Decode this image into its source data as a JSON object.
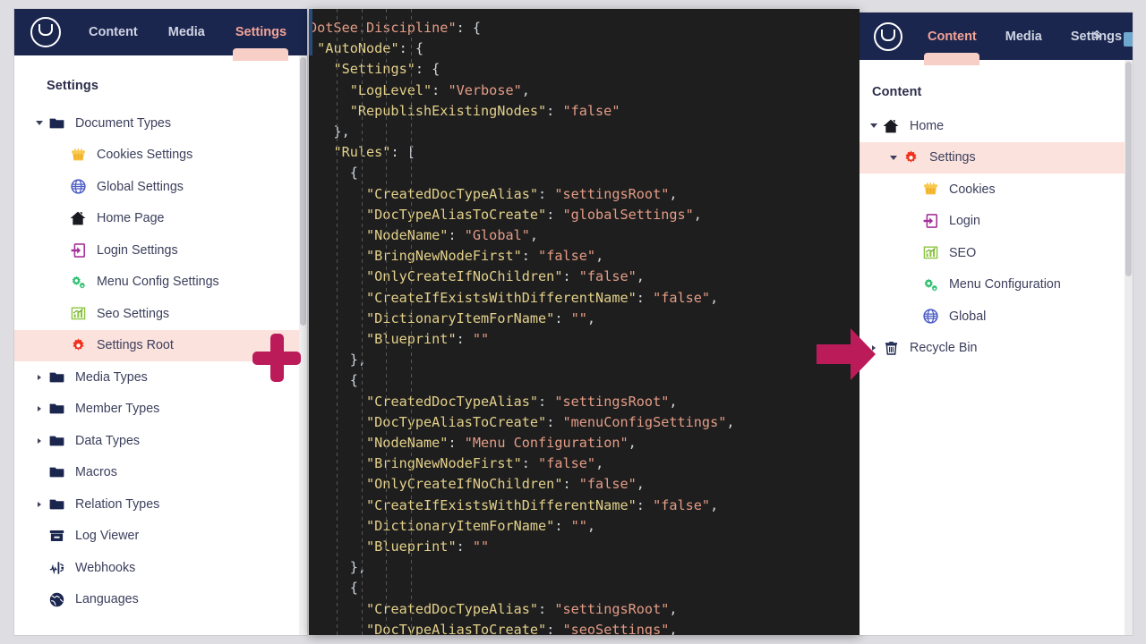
{
  "left_window": {
    "nav": {
      "logo_icon": "umbraco-logo-icon",
      "tabs": [
        {
          "label": "Content",
          "active": false
        },
        {
          "label": "Media",
          "active": false
        },
        {
          "label": "Settings",
          "active": true
        }
      ],
      "cut_text": "s"
    },
    "panel_title": "Settings",
    "tree": [
      {
        "label": "Document Types",
        "icon": "folder-icon",
        "caret": "open",
        "depth": 0,
        "selected": false
      },
      {
        "label": "Cookies Settings",
        "icon": "cookie-icon",
        "caret": "none",
        "depth": 1,
        "selected": false
      },
      {
        "label": "Global Settings",
        "icon": "globe-icon",
        "caret": "none",
        "depth": 1,
        "selected": false
      },
      {
        "label": "Home Page",
        "icon": "home-icon",
        "caret": "none",
        "depth": 1,
        "selected": false
      },
      {
        "label": "Login Settings",
        "icon": "login-icon",
        "caret": "none",
        "depth": 1,
        "selected": false
      },
      {
        "label": "Menu Config Settings",
        "icon": "gears-icon",
        "caret": "none",
        "depth": 1,
        "selected": false
      },
      {
        "label": "Seo Settings",
        "icon": "bar-chart-icon",
        "caret": "none",
        "depth": 1,
        "selected": false
      },
      {
        "label": "Settings Root",
        "icon": "gear-icon",
        "caret": "none",
        "depth": 1,
        "selected": true
      },
      {
        "label": "Media Types",
        "icon": "folder-icon",
        "caret": "closed",
        "depth": 0,
        "selected": false
      },
      {
        "label": "Member Types",
        "icon": "folder-icon",
        "caret": "closed",
        "depth": 0,
        "selected": false
      },
      {
        "label": "Data Types",
        "icon": "folder-icon",
        "caret": "closed",
        "depth": 0,
        "selected": false
      },
      {
        "label": "Macros",
        "icon": "folder-icon",
        "caret": "none",
        "depth": 0,
        "selected": false
      },
      {
        "label": "Relation Types",
        "icon": "folder-icon",
        "caret": "closed",
        "depth": 0,
        "selected": false
      },
      {
        "label": "Log Viewer",
        "icon": "log-viewer-icon",
        "caret": "none",
        "depth": 0,
        "selected": false
      },
      {
        "label": "Webhooks",
        "icon": "webhook-icon",
        "caret": "none",
        "depth": 0,
        "selected": false
      },
      {
        "label": "Languages",
        "icon": "language-globe-icon",
        "caret": "none",
        "depth": 0,
        "selected": false
      }
    ]
  },
  "code_panel": {
    "language": "json",
    "lines": [
      [
        {
          "t": "s",
          "v": "DotSee.Discipline\""
        },
        {
          "t": "p",
          "v": ": {"
        }
      ],
      [
        {
          "t": "p",
          "v": " "
        },
        {
          "t": "k",
          "v": "\"AutoNode\""
        },
        {
          "t": "p",
          "v": ": {"
        }
      ],
      [
        {
          "t": "p",
          "v": "   "
        },
        {
          "t": "k",
          "v": "\"Settings\""
        },
        {
          "t": "p",
          "v": ": {"
        }
      ],
      [
        {
          "t": "p",
          "v": "     "
        },
        {
          "t": "k",
          "v": "\"LogLevel\""
        },
        {
          "t": "p",
          "v": ": "
        },
        {
          "t": "s",
          "v": "\"Verbose\""
        },
        {
          "t": "p",
          "v": ","
        }
      ],
      [
        {
          "t": "p",
          "v": "     "
        },
        {
          "t": "k",
          "v": "\"RepublishExistingNodes\""
        },
        {
          "t": "p",
          "v": ": "
        },
        {
          "t": "s",
          "v": "\"false\""
        }
      ],
      [
        {
          "t": "p",
          "v": "   },"
        }
      ],
      [
        {
          "t": "p",
          "v": "   "
        },
        {
          "t": "k",
          "v": "\"Rules\""
        },
        {
          "t": "p",
          "v": ": ["
        }
      ],
      [
        {
          "t": "p",
          "v": "     {"
        }
      ],
      [
        {
          "t": "p",
          "v": "       "
        },
        {
          "t": "k",
          "v": "\"CreatedDocTypeAlias\""
        },
        {
          "t": "p",
          "v": ": "
        },
        {
          "t": "s",
          "v": "\"settingsRoot\""
        },
        {
          "t": "p",
          "v": ","
        }
      ],
      [
        {
          "t": "p",
          "v": "       "
        },
        {
          "t": "k",
          "v": "\"DocTypeAliasToCreate\""
        },
        {
          "t": "p",
          "v": ": "
        },
        {
          "t": "s",
          "v": "\"globalSettings\""
        },
        {
          "t": "p",
          "v": ","
        }
      ],
      [
        {
          "t": "p",
          "v": "       "
        },
        {
          "t": "k",
          "v": "\"NodeName\""
        },
        {
          "t": "p",
          "v": ": "
        },
        {
          "t": "s",
          "v": "\"Global\""
        },
        {
          "t": "p",
          "v": ","
        }
      ],
      [
        {
          "t": "p",
          "v": "       "
        },
        {
          "t": "k",
          "v": "\"BringNewNodeFirst\""
        },
        {
          "t": "p",
          "v": ": "
        },
        {
          "t": "s",
          "v": "\"false\""
        },
        {
          "t": "p",
          "v": ","
        }
      ],
      [
        {
          "t": "p",
          "v": "       "
        },
        {
          "t": "k",
          "v": "\"OnlyCreateIfNoChildren\""
        },
        {
          "t": "p",
          "v": ": "
        },
        {
          "t": "s",
          "v": "\"false\""
        },
        {
          "t": "p",
          "v": ","
        }
      ],
      [
        {
          "t": "p",
          "v": "       "
        },
        {
          "t": "k",
          "v": "\"CreateIfExistsWithDifferentName\""
        },
        {
          "t": "p",
          "v": ": "
        },
        {
          "t": "s",
          "v": "\"false\""
        },
        {
          "t": "p",
          "v": ","
        }
      ],
      [
        {
          "t": "p",
          "v": "       "
        },
        {
          "t": "k",
          "v": "\"DictionaryItemForName\""
        },
        {
          "t": "p",
          "v": ": "
        },
        {
          "t": "s",
          "v": "\"\""
        },
        {
          "t": "p",
          "v": ","
        }
      ],
      [
        {
          "t": "p",
          "v": "       "
        },
        {
          "t": "k",
          "v": "\"Blueprint\""
        },
        {
          "t": "p",
          "v": ": "
        },
        {
          "t": "s",
          "v": "\"\""
        }
      ],
      [
        {
          "t": "p",
          "v": "     },"
        }
      ],
      [
        {
          "t": "p",
          "v": "     {"
        }
      ],
      [
        {
          "t": "p",
          "v": "       "
        },
        {
          "t": "k",
          "v": "\"CreatedDocTypeAlias\""
        },
        {
          "t": "p",
          "v": ": "
        },
        {
          "t": "s",
          "v": "\"settingsRoot\""
        },
        {
          "t": "p",
          "v": ","
        }
      ],
      [
        {
          "t": "p",
          "v": "       "
        },
        {
          "t": "k",
          "v": "\"DocTypeAliasToCreate\""
        },
        {
          "t": "p",
          "v": ": "
        },
        {
          "t": "s",
          "v": "\"menuConfigSettings\""
        },
        {
          "t": "p",
          "v": ","
        }
      ],
      [
        {
          "t": "p",
          "v": "       "
        },
        {
          "t": "k",
          "v": "\"NodeName\""
        },
        {
          "t": "p",
          "v": ": "
        },
        {
          "t": "s",
          "v": "\"Menu Configuration\""
        },
        {
          "t": "p",
          "v": ","
        }
      ],
      [
        {
          "t": "p",
          "v": "       "
        },
        {
          "t": "k",
          "v": "\"BringNewNodeFirst\""
        },
        {
          "t": "p",
          "v": ": "
        },
        {
          "t": "s",
          "v": "\"false\""
        },
        {
          "t": "p",
          "v": ","
        }
      ],
      [
        {
          "t": "p",
          "v": "       "
        },
        {
          "t": "k",
          "v": "\"OnlyCreateIfNoChildren\""
        },
        {
          "t": "p",
          "v": ": "
        },
        {
          "t": "s",
          "v": "\"false\""
        },
        {
          "t": "p",
          "v": ","
        }
      ],
      [
        {
          "t": "p",
          "v": "       "
        },
        {
          "t": "k",
          "v": "\"CreateIfExistsWithDifferentName\""
        },
        {
          "t": "p",
          "v": ": "
        },
        {
          "t": "s",
          "v": "\"false\""
        },
        {
          "t": "p",
          "v": ","
        }
      ],
      [
        {
          "t": "p",
          "v": "       "
        },
        {
          "t": "k",
          "v": "\"DictionaryItemForName\""
        },
        {
          "t": "p",
          "v": ": "
        },
        {
          "t": "s",
          "v": "\"\""
        },
        {
          "t": "p",
          "v": ","
        }
      ],
      [
        {
          "t": "p",
          "v": "       "
        },
        {
          "t": "k",
          "v": "\"Blueprint\""
        },
        {
          "t": "p",
          "v": ": "
        },
        {
          "t": "s",
          "v": "\"\""
        }
      ],
      [
        {
          "t": "p",
          "v": "     },"
        }
      ],
      [
        {
          "t": "p",
          "v": "     {"
        }
      ],
      [
        {
          "t": "p",
          "v": "       "
        },
        {
          "t": "k",
          "v": "\"CreatedDocTypeAlias\""
        },
        {
          "t": "p",
          "v": ": "
        },
        {
          "t": "s",
          "v": "\"settingsRoot\""
        },
        {
          "t": "p",
          "v": ","
        }
      ],
      [
        {
          "t": "p",
          "v": "       "
        },
        {
          "t": "k",
          "v": "\"DocTypeAliasToCreate\""
        },
        {
          "t": "p",
          "v": ": "
        },
        {
          "t": "s",
          "v": "\"seoSettings\""
        },
        {
          "t": "p",
          "v": ","
        }
      ]
    ]
  },
  "right_window": {
    "nav": {
      "logo_icon": "umbraco-logo-icon",
      "tabs": [
        {
          "label": "Content",
          "active": true
        },
        {
          "label": "Media",
          "active": false
        },
        {
          "label": "Settings",
          "active": false
        }
      ],
      "cut_text": "s"
    },
    "panel_title": "Content",
    "tree": [
      {
        "label": "Home",
        "icon": "home-icon",
        "caret": "open",
        "depth": 0,
        "selected": false
      },
      {
        "label": "Settings",
        "icon": "gear-icon",
        "caret": "open",
        "depth": 1,
        "selected": true
      },
      {
        "label": "Cookies",
        "icon": "cookie-icon",
        "caret": "none",
        "depth": 2,
        "selected": false
      },
      {
        "label": "Login",
        "icon": "login-icon",
        "caret": "none",
        "depth": 2,
        "selected": false
      },
      {
        "label": "SEO",
        "icon": "bar-chart-icon",
        "caret": "none",
        "depth": 2,
        "selected": false
      },
      {
        "label": "Menu Configuration",
        "icon": "gears-icon",
        "caret": "none",
        "depth": 2,
        "selected": false
      },
      {
        "label": "Global",
        "icon": "globe-icon",
        "caret": "none",
        "depth": 2,
        "selected": false
      },
      {
        "label": "Recycle Bin",
        "icon": "trash-icon",
        "caret": "closed",
        "depth": 0,
        "selected": false
      }
    ]
  },
  "annotations": [
    {
      "name": "plus-marker",
      "icon": "plus-icon",
      "color": "#bb1b59"
    },
    {
      "name": "arrow-marker",
      "icon": "arrow-right-icon",
      "color": "#bb1b59"
    }
  ],
  "colors": {
    "navbar": "#1b264f",
    "accent_pink": "#f3a395",
    "selection": "#fbe2dd",
    "annotation": "#bb1b59",
    "code_bg": "#1e1e1e",
    "page_bg": "#dedee2"
  }
}
